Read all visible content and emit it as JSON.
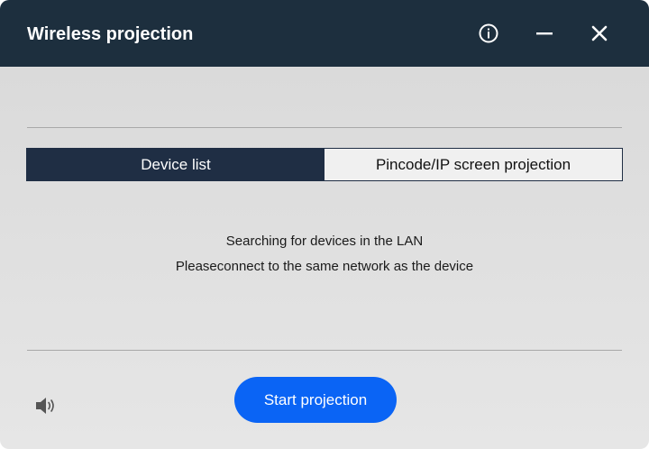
{
  "window": {
    "title": "Wireless projection"
  },
  "titlebar": {
    "info_icon": "info-circle-icon",
    "minimize_icon": "minimize-icon",
    "close_icon": "close-icon"
  },
  "tabs": [
    {
      "label": "Device list",
      "active": true
    },
    {
      "label": "Pincode/IP screen projection",
      "active": false
    }
  ],
  "status": {
    "line1": "Searching for devices in the LAN",
    "line2": "Pleaseconnect to the same network as the device"
  },
  "footer": {
    "sound_icon": "speaker-icon",
    "start_label": "Start projection"
  },
  "colors": {
    "titlebar": "#1d2f3e",
    "tab_active": "#1f2e44",
    "accent": "#0a64f5"
  }
}
